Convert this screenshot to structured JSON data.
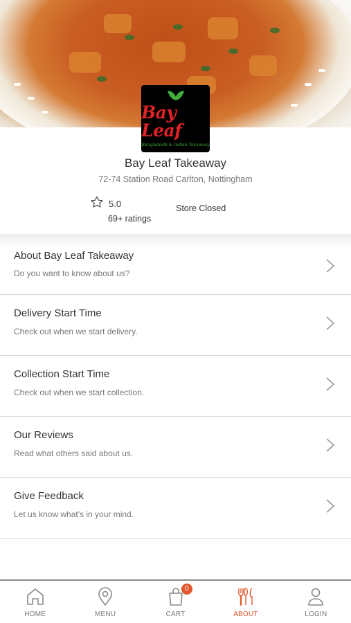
{
  "hero": {
    "image": "curry-dish-photo"
  },
  "logo": {
    "brand": "Bay Leaf",
    "tagline": "Bangladeshi & Indian Takeaway"
  },
  "store": {
    "name": "Bay Leaf Takeaway",
    "address": "72-74 Station Road Carlton, Nottingham",
    "rating": "5.0",
    "rating_count": "69+ ratings",
    "status": "Store Closed"
  },
  "menu": {
    "items": [
      {
        "title": "About Bay Leaf Takeaway",
        "subtitle": "Do you want to know about us?"
      },
      {
        "title": "Delivery Start Time",
        "subtitle": "Check out when we start delivery."
      },
      {
        "title": "Collection Start Time",
        "subtitle": "Check out when we start collection."
      },
      {
        "title": "Our Reviews",
        "subtitle": "Read what others said about us."
      },
      {
        "title": "Give Feedback",
        "subtitle": "Let us know what's in your mind."
      }
    ]
  },
  "nav": {
    "items": [
      {
        "label": "HOME",
        "icon": "home-icon"
      },
      {
        "label": "MENU",
        "icon": "location-pin-icon"
      },
      {
        "label": "CART",
        "icon": "shopping-bag-icon"
      },
      {
        "label": "ABOUT",
        "icon": "cutlery-icon",
        "active": true
      },
      {
        "label": "LOGIN",
        "icon": "user-icon"
      }
    ],
    "cart_count": "0"
  },
  "colors": {
    "accent": "#e2572b",
    "logo_red": "#e02328",
    "logo_green": "#3fae3a"
  }
}
